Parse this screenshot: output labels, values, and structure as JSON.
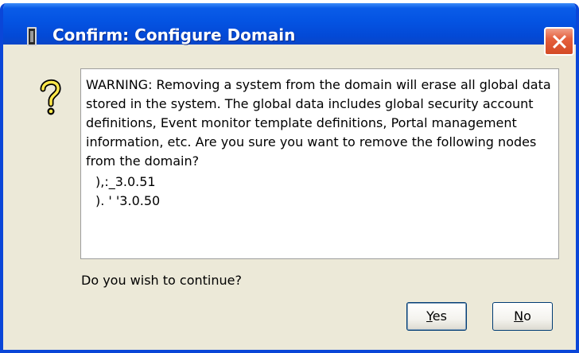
{
  "window": {
    "title": "Confirm: Configure Domain",
    "title_icon": "server-icon",
    "close_icon": "close-icon"
  },
  "dialog": {
    "icon": "question-icon",
    "message": "WARNING: Removing a system from the domain will erase all global data stored in the system. The global data includes global security account definitions, Event monitor template definitions, Portal management information, etc. Are you sure you want to remove the following nodes from the domain?",
    "nodes": [
      "),:_3.0.51",
      "). ' '3.0.50"
    ],
    "question": "Do you wish to continue?"
  },
  "buttons": {
    "yes": {
      "accel": "Y",
      "rest": "es"
    },
    "no": {
      "accel": "N",
      "rest": "o"
    }
  },
  "colors": {
    "titlebar": "#0453e2",
    "frame": "#0a46d8",
    "dialog_bg": "#ece9d8",
    "close": "#e5603d"
  }
}
